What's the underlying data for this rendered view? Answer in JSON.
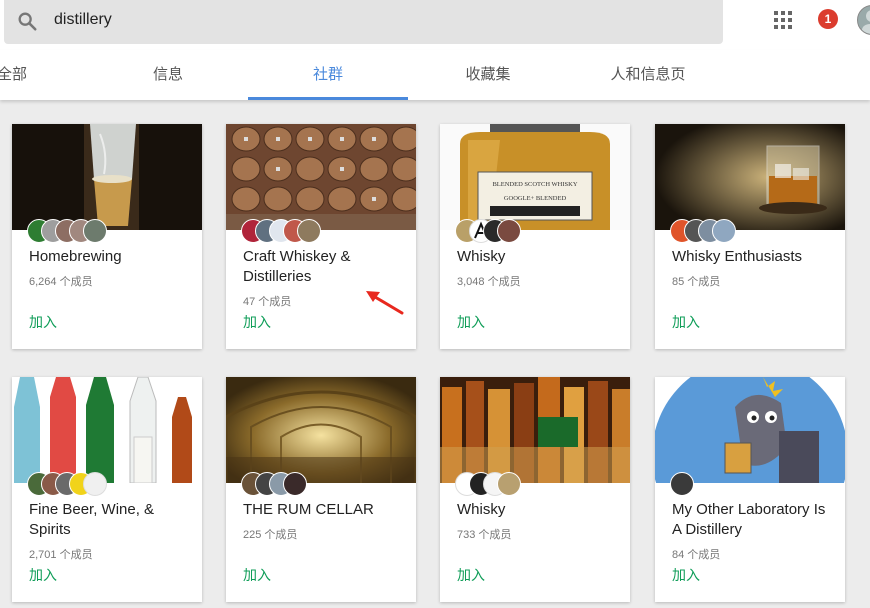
{
  "search": {
    "query": "distillery"
  },
  "header": {
    "notification_count": "1"
  },
  "tabs": [
    {
      "label": "全部"
    },
    {
      "label": "信息"
    },
    {
      "label": "社群"
    },
    {
      "label": "收藏集"
    },
    {
      "label": "人和信息页"
    }
  ],
  "active_tab": "社群",
  "communities": [
    {
      "name": "Homebrewing",
      "members": "6,264 个成员",
      "join": "加入"
    },
    {
      "name": "Craft Whiskey & Distilleries",
      "members": "47 个成员",
      "join": "加入"
    },
    {
      "name": "Whisky",
      "members": "3,048 个成员",
      "join": "加入"
    },
    {
      "name": "Whisky Enthusiasts",
      "members": "85 个成员",
      "join": "加入"
    },
    {
      "name": "Fine Beer, Wine, & Spirits",
      "members": "2,701 个成员",
      "join": "加入"
    },
    {
      "name": "THE RUM CELLAR",
      "members": "225 个成员",
      "join": "加入"
    },
    {
      "name": "Whisky",
      "members": "733 个成员",
      "join": "加入"
    },
    {
      "name": "My Other Laboratory Is A Distillery",
      "members": "84 个成员",
      "join": "加入"
    }
  ],
  "image_labels": {
    "whisky_bottle_line1": "BLENDED SCOTCH WHISKY",
    "whisky_bottle_line2": "GOOGLE+ BLENDED"
  },
  "colors": {
    "accent": "#4a89dc",
    "join": "#0f9d58",
    "notification": "#db3c2e"
  }
}
